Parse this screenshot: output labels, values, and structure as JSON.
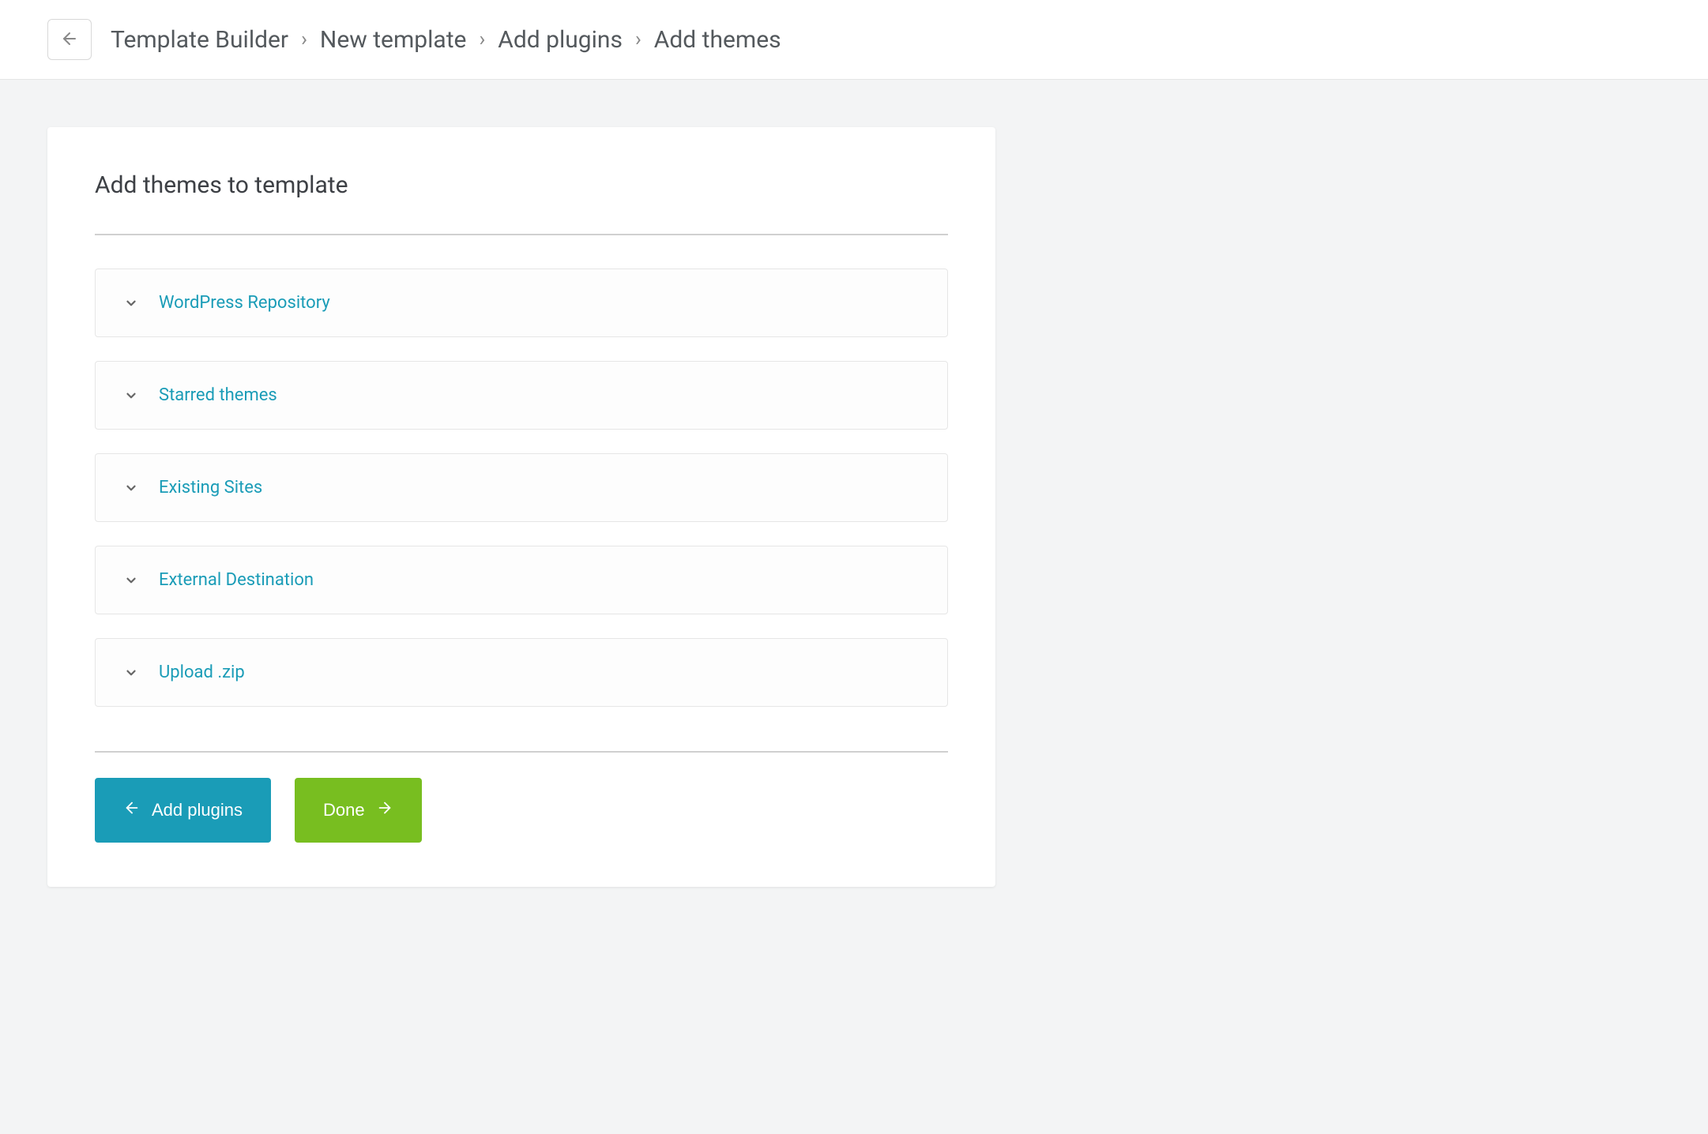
{
  "header": {
    "breadcrumb": [
      "Template Builder",
      "New template",
      "Add plugins",
      "Add themes"
    ]
  },
  "card": {
    "title": "Add themes to template"
  },
  "accordions": [
    {
      "label": "WordPress Repository"
    },
    {
      "label": "Starred themes"
    },
    {
      "label": "Existing Sites"
    },
    {
      "label": "External Destination"
    },
    {
      "label": "Upload .zip"
    }
  ],
  "buttons": {
    "back_label": "Add plugins",
    "done_label": "Done"
  }
}
